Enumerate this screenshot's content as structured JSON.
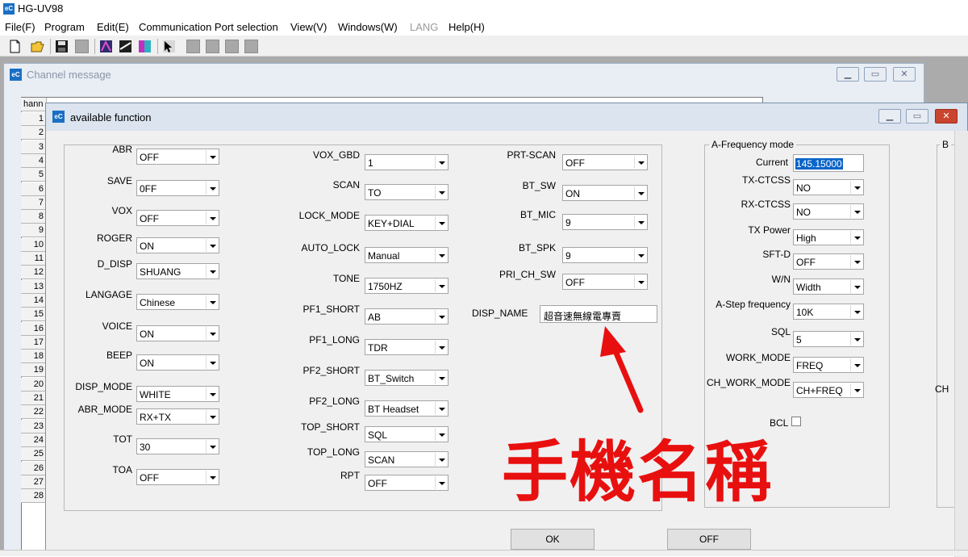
{
  "app": {
    "title": "HG-UV98"
  },
  "menu": [
    "File(F)",
    "Program",
    "Edit(E)",
    "Communication Port selection",
    "View(V)",
    "Windows(W)",
    "LANG",
    "Help(H)"
  ],
  "channel_window": {
    "title": "Channel message",
    "header_label": "hann",
    "row_numbers": [
      "1",
      "2",
      "3",
      "4",
      "5",
      "6",
      "7",
      "8",
      "9",
      "10",
      "11",
      "12",
      "13",
      "14",
      "15",
      "16",
      "17",
      "18",
      "19",
      "20",
      "21",
      "22",
      "23",
      "24",
      "25",
      "26",
      "27",
      "28"
    ]
  },
  "dialog": {
    "title": "available function",
    "col1": [
      {
        "label": "ABR",
        "value": "OFF"
      },
      {
        "label": "SAVE",
        "value": "0FF"
      },
      {
        "label": "VOX",
        "value": "OFF"
      },
      {
        "label": "ROGER",
        "value": "ON"
      },
      {
        "label": "D_DISP",
        "value": "SHUANG"
      },
      {
        "label": "LANGAGE",
        "value": "Chinese"
      },
      {
        "label": "VOICE",
        "value": "ON"
      },
      {
        "label": "BEEP",
        "value": "ON"
      },
      {
        "label": "DISP_MODE",
        "value": "WHITE"
      },
      {
        "label": "ABR_MODE",
        "value": "RX+TX"
      },
      {
        "label": "TOT",
        "value": "30"
      },
      {
        "label": "TOA",
        "value": "OFF"
      }
    ],
    "col2": [
      {
        "label": "VOX_GBD",
        "value": "1"
      },
      {
        "label": "SCAN",
        "value": "TO"
      },
      {
        "label": "LOCK_MODE",
        "value": "KEY+DIAL"
      },
      {
        "label": "AUTO_LOCK",
        "value": "Manual"
      },
      {
        "label": "TONE",
        "value": "1750HZ"
      },
      {
        "label": "PF1_SHORT",
        "value": "AB"
      },
      {
        "label": "PF1_LONG",
        "value": "TDR"
      },
      {
        "label": "PF2_SHORT",
        "value": "BT_Switch"
      },
      {
        "label": "PF2_LONG",
        "value": "BT Headset"
      },
      {
        "label": "TOP_SHORT",
        "value": "SQL"
      },
      {
        "label": "TOP_LONG",
        "value": "SCAN"
      },
      {
        "label": "RPT",
        "value": "OFF"
      }
    ],
    "col3": [
      {
        "label": "PRT-SCAN",
        "value": "OFF"
      },
      {
        "label": "BT_SW",
        "value": "ON"
      },
      {
        "label": "BT_MIC",
        "value": "9"
      },
      {
        "label": "BT_SPK",
        "value": "9"
      },
      {
        "label": "PRI_CH_SW",
        "value": "OFF"
      }
    ],
    "disp_name": {
      "label": "DISP_NAME",
      "value": "超音速無線電專賣"
    },
    "freq_mode": {
      "legend": "A-Frequency mode",
      "current_label": "Current",
      "current_value": "145.15000",
      "fields": [
        {
          "label": "TX-CTCSS",
          "value": "NO"
        },
        {
          "label": "RX-CTCSS",
          "value": "NO"
        },
        {
          "label": "TX Power",
          "value": "High"
        },
        {
          "label": "SFT-D",
          "value": "OFF"
        },
        {
          "label": "W/N",
          "value": "Width"
        },
        {
          "label": "A-Step frequency",
          "value": "10K"
        },
        {
          "label": "SQL",
          "value": "5"
        },
        {
          "label": "WORK_MODE",
          "value": "FREQ"
        },
        {
          "label": "CH_WORK_MODE",
          "value": "CH+FREQ"
        }
      ],
      "bcl_label": "BCL"
    },
    "right_cut": {
      "legend": "B",
      "label": "CH"
    },
    "ok_label": "OK",
    "off_label": "OFF"
  },
  "annotation": {
    "text": "手機名稱",
    "color": "#e8100f"
  }
}
